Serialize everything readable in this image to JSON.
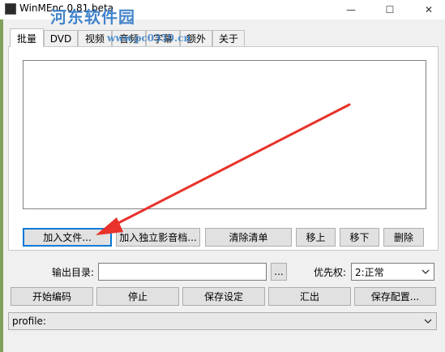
{
  "window": {
    "title": "WinMEnc 0.81 beta",
    "controls": {
      "minimize": "—",
      "maximize": "☐",
      "close": "✕"
    }
  },
  "watermark": {
    "logo": "河东软件园",
    "url": "www.pc0359.cn"
  },
  "tabs": [
    {
      "label": "批量",
      "active": true
    },
    {
      "label": "DVD",
      "active": false
    },
    {
      "label": "视频",
      "active": false
    },
    {
      "label": "音频",
      "active": false
    },
    {
      "label": "字幕",
      "active": false
    },
    {
      "label": "额外",
      "active": false
    },
    {
      "label": "关于",
      "active": false
    }
  ],
  "batch": {
    "buttons": {
      "add_file": "加入文件...",
      "add_standalone": "加入独立影音档...",
      "clear_list": "清除清单",
      "move_up": "移上",
      "move_down": "移下",
      "delete": "删除"
    }
  },
  "output": {
    "label": "输出目录:",
    "value": "",
    "browse": "..."
  },
  "priority": {
    "label": "优先权:",
    "selected": "2:正常"
  },
  "actions": {
    "start": "开始编码",
    "stop": "停止",
    "save_settings": "保存设定",
    "export": "汇出",
    "save_config": "保存配置..."
  },
  "profile": {
    "selected": "profile:"
  },
  "colors": {
    "annotation_arrow": "#e8322a",
    "focus": "#0078d7",
    "watermark": "#2f78c8"
  }
}
